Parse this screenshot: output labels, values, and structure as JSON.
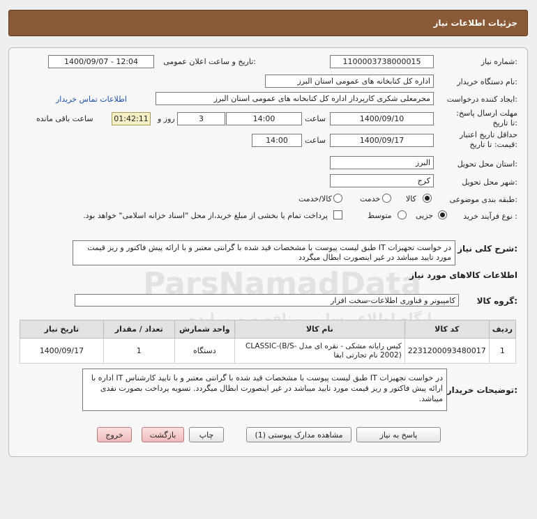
{
  "header": {
    "title": "جزئیات اطلاعات نیاز"
  },
  "form": {
    "need_number_label": "شماره نیاز:",
    "need_number": "1100003738000015",
    "announce_label": "تاریخ و ساعت اعلان عمومی:",
    "announce_value": "1400/09/07 - 12:04",
    "buyer_org_label": "نام دستگاه خریدار:",
    "buyer_org": "اداره کل کتابخانه های عمومی استان البرز",
    "creator_label": "ایجاد کننده درخواست:",
    "creator": "محرمعلی شکری کارپرداز اداره کل کتابخانه های عمومی استان البرز",
    "contact_link": "اطلاعات تماس خریدار",
    "reply_deadline_label": "مهلت ارسال پاسخ: تا تاریخ:",
    "reply_date": "1400/09/10",
    "time_label": "ساعت",
    "reply_time": "14:00",
    "days_value": "3",
    "days_and_label": "روز و",
    "remaining_time": "01:42:11",
    "remaining_label": "ساعت باقی مانده",
    "price_validity_label": "حداقل تاریخ اعتبار قیمت: تا تاریخ:",
    "validity_date": "1400/09/17",
    "validity_time": "14:00",
    "province_label": "استان محل تحویل:",
    "province": "البرز",
    "city_label": "شهر محل تحویل:",
    "city": "کرج",
    "category_label": "طبقه بندی موضوعی:",
    "category_options": [
      "کالا",
      "خدمت",
      "کالا/خدمت"
    ],
    "purchase_type_label": "نوع فرآیند خرید :",
    "purchase_options": [
      "جزیی",
      "متوسط"
    ],
    "payment_note": "پرداخت تمام یا بخشی از مبلغ خرید،از محل \"اسناد خزانه اسلامی\" خواهد بود."
  },
  "summary": {
    "label": "شرح کلی نیاز:",
    "text": "در خواست تجهیزات IT طبق لیست پیوست با مشخصات قید شده با گرانتی معتبر و با ارائه پیش فاکتور و ریز قیمت مورد تایید میباشد در غیر اینصورت ابطال میگردد"
  },
  "goods": {
    "section_title": "اطلاعات کالاهای مورد نیاز",
    "group_label": "گروه کالا:",
    "group_value": "کامپیوتر و فناوری اطلاعات-سخت افزار",
    "columns": [
      "ردیف",
      "کد کالا",
      "نام کالا",
      "واحد شمارش",
      "تعداد / مقدار",
      "تاریخ نیاز"
    ],
    "rows": [
      {
        "row": "1",
        "code": "2231200093480017",
        "name": "کیس رایانه مشکی - نقره ای مدل CLASSIC-(B/S-2002) نام تجارتی ایفا",
        "unit": "دستگاه",
        "qty": "1",
        "date": "1400/09/17"
      }
    ]
  },
  "buyer_notes": {
    "label": "توضیحات خریدار:",
    "text": "در خواست تجهیزات IT طبق لیست پیوست با مشخصات قید شده با گرانتی معتبر و با تایید کارشناس IT اداره با ارائه پیش فاکتور و ریز قیمت مورد تایید میباشد در غیر اینصورت ابطال میگردد. تسویه پرداخت بصورت نقدی میباشد."
  },
  "buttons": {
    "reply": "پاسخ به نیاز",
    "attachments": "مشاهده مدارک پیوستی (1)",
    "print": "چاپ",
    "back": "بازگشت",
    "exit": "خروج"
  },
  "watermark": {
    "brand": "ParsNamadData",
    "persian": "پایگاه اطلاع رسانی مناقصه و مزایده",
    "phone": "۰۲۱-۸۸۳۴۹۶۷۰-۵"
  }
}
